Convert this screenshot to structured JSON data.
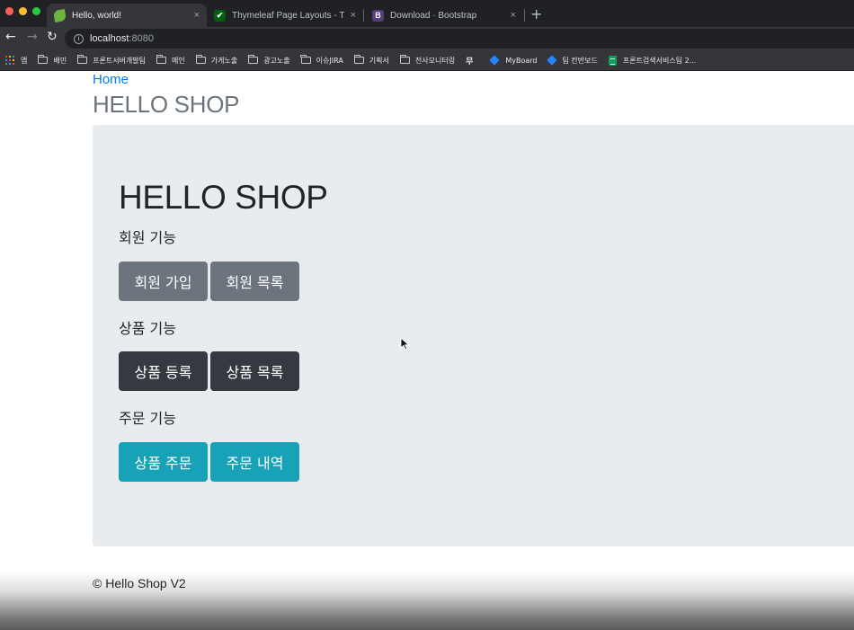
{
  "browser": {
    "tabs": [
      {
        "title": "Hello, world!",
        "active": true,
        "favicon": "spring-leaf-icon"
      },
      {
        "title": "Thymeleaf Page Layouts - Thy",
        "active": false,
        "favicon": "thymeleaf-check-icon"
      },
      {
        "title": "Download · Bootstrap",
        "active": false,
        "favicon": "bootstrap-b-icon"
      }
    ],
    "favicon_letters": {
      "check": "✔",
      "b": "B"
    },
    "new_tab_symbol": "+",
    "close_symbol": "×",
    "nav": {
      "back": "←",
      "forward": "→",
      "reload": "↻"
    },
    "url": {
      "host": "localhost",
      "port": ":8080",
      "info_symbol": "i"
    },
    "bookmarks": [
      {
        "label": "앱",
        "icon": "apps-grid-icon"
      },
      {
        "label": "배민",
        "icon": "folder-icon"
      },
      {
        "label": "프론트서버개발팀",
        "icon": "folder-icon"
      },
      {
        "label": "메인",
        "icon": "folder-icon"
      },
      {
        "label": "가게노출",
        "icon": "folder-icon"
      },
      {
        "label": "광고노출",
        "icon": "folder-icon"
      },
      {
        "label": "이슈JIRA",
        "icon": "folder-icon"
      },
      {
        "label": "기획서",
        "icon": "folder-icon"
      },
      {
        "label": "전사모니터링",
        "icon": "folder-icon"
      },
      {
        "label": "",
        "icon": "mu-icon",
        "glyph": "무"
      },
      {
        "label": "MyBoard",
        "icon": "jira-icon"
      },
      {
        "label": "팀 칸반보드",
        "icon": "jira-icon"
      },
      {
        "label": "프론트검색서비스팀 2...",
        "icon": "sheets-icon"
      }
    ]
  },
  "page": {
    "home_link": "Home",
    "header_title": "HELLO SHOP",
    "jumbotron": {
      "title": "HELLO SHOP",
      "sections": [
        {
          "label": "회원 기능",
          "buttons": [
            "회원 가입",
            "회원 목록"
          ],
          "style": "secondary"
        },
        {
          "label": "상품 기능",
          "buttons": [
            "상품 등록",
            "상품 목록"
          ],
          "style": "dark"
        },
        {
          "label": "주문 기능",
          "buttons": [
            "상품 주문",
            "주문 내역"
          ],
          "style": "info"
        }
      ]
    },
    "footer": "© Hello Shop V2"
  },
  "colors": {
    "link": "#007bff",
    "secondary": "#6c757d",
    "dark": "#343a40",
    "info": "#17a2b8",
    "jumbotron_bg": "#e9ecef"
  }
}
